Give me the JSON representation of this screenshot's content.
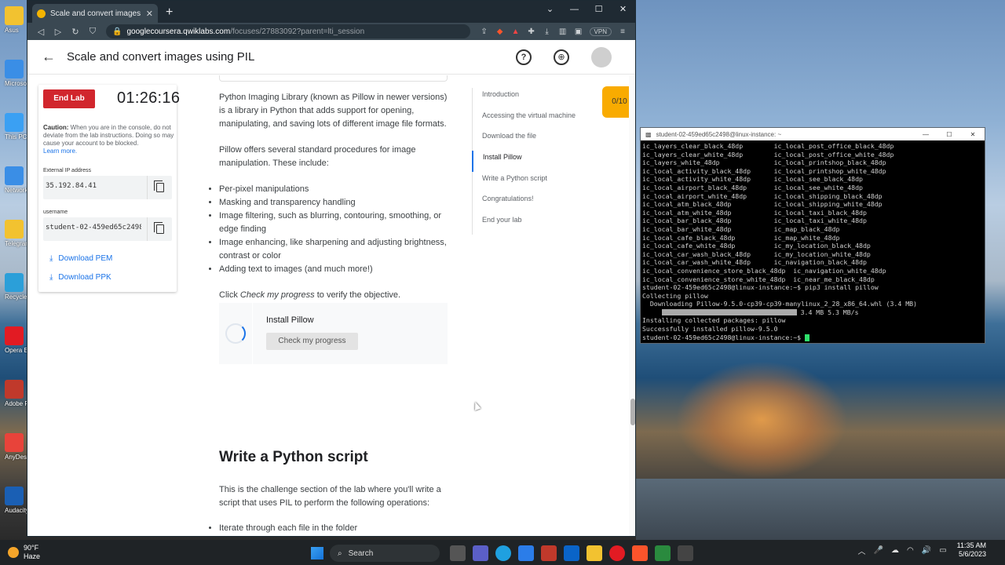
{
  "browser": {
    "tab_title": "Scale and convert images using PIL",
    "url_host": "googlecoursera.qwiklabs.com",
    "url_path": "/focuses/27883092?parent=lti_session",
    "vpn": "VPN"
  },
  "header": {
    "title": "Scale and convert images using PIL"
  },
  "lab": {
    "end_label": "End Lab",
    "timer": "01:26:16",
    "caution_bold": "Caution:",
    "caution_text": " When you are in the console, do not deviate from the lab instructions. Doing so may cause your account to be blocked.",
    "learn_more": "Learn more.",
    "ip_label": "External IP address",
    "ip_value": "35.192.84.41",
    "user_label": "username",
    "user_value": "student-02-459ed65c2498",
    "download_pem": "Download PEM",
    "download_ppk": "Download PPK"
  },
  "article": {
    "p1": "Python Imaging Library (known as Pillow in newer versions) is a library in Python that adds support for opening, manipulating, and saving lots of different image file formats.",
    "p2": "Pillow offers several standard procedures for image manipulation. These include:",
    "bullets": [
      "Per-pixel manipulations",
      "Masking and transparency handling",
      "Image filtering, such as blurring, contouring, smoothing, or edge finding",
      "Image enhancing, like sharpening and adjusting brightness, contrast or color",
      "Adding text to images (and much more!)"
    ],
    "click_pre": "Click ",
    "click_em": "Check my progress",
    "click_post": " to verify the objective.",
    "check_label": "Install Pillow",
    "check_button": "Check my progress",
    "h2": "Write a Python script",
    "p3": "This is the challenge section of the lab where you'll write a script that uses PIL to perform the following operations:",
    "bullet2": "Iterate through each file in the folder"
  },
  "outline": [
    "Introduction",
    "Accessing the virtual machine",
    "Download the file",
    "Install Pillow",
    "Write a Python script",
    "Congratulations!",
    "End your lab"
  ],
  "score": "0/10",
  "terminal": {
    "title": "student-02-459ed65c2498@linux-instance: ~",
    "lines": [
      "ic_layers_clear_black_48dp        ic_local_post_office_black_48dp",
      "ic_layers_clear_white_48dp        ic_local_post_office_white_48dp",
      "ic_layers_white_48dp              ic_local_printshop_black_48dp",
      "ic_local_activity_black_48dp      ic_local_printshop_white_48dp",
      "ic_local_activity_white_48dp      ic_local_see_black_48dp",
      "ic_local_airport_black_48dp       ic_local_see_white_48dp",
      "ic_local_airport_white_48dp       ic_local_shipping_black_48dp",
      "ic_local_atm_black_48dp           ic_local_shipping_white_48dp",
      "ic_local_atm_white_48dp           ic_local_taxi_black_48dp",
      "ic_local_bar_black_48dp           ic_local_taxi_white_48dp",
      "ic_local_bar_white_48dp           ic_map_black_48dp",
      "ic_local_cafe_black_48dp          ic_map_white_48dp",
      "ic_local_cafe_white_48dp          ic_my_location_black_48dp",
      "ic_local_car_wash_black_48dp      ic_my_location_white_48dp",
      "ic_local_car_wash_white_48dp      ic_navigation_black_48dp",
      "ic_local_convenience_store_black_48dp  ic_navigation_white_48dp",
      "ic_local_convenience_store_white_48dp  ic_near_me_black_48dp",
      "student-02-459ed65c2498@linux-instance:~$ pip3 install pillow",
      "Collecting pillow",
      "  Downloading Pillow-9.5.0-cp39-cp39-manylinux_2_28_x86_64.whl (3.4 MB)"
    ],
    "progress_suffix": " 3.4 MB 5.3 MB/s",
    "tail": [
      "Installing collected packages: pillow",
      "Successfully installed pillow-9.5.0"
    ],
    "prompt": "student-02-459ed65c2498@linux-instance:~$ "
  },
  "desktop_icons": [
    "Asus",
    "Microsoft Partitio",
    "This PC",
    "Network",
    "Telegram Desktop",
    "Recycle Bin",
    "Opera Browser",
    "Adobe Reader",
    "AnyDesk",
    "Audacity"
  ],
  "taskbar": {
    "temp": "90°F",
    "cond": "Haze",
    "search": "Search",
    "time": "11:35 AM",
    "date": "5/6/2023"
  }
}
